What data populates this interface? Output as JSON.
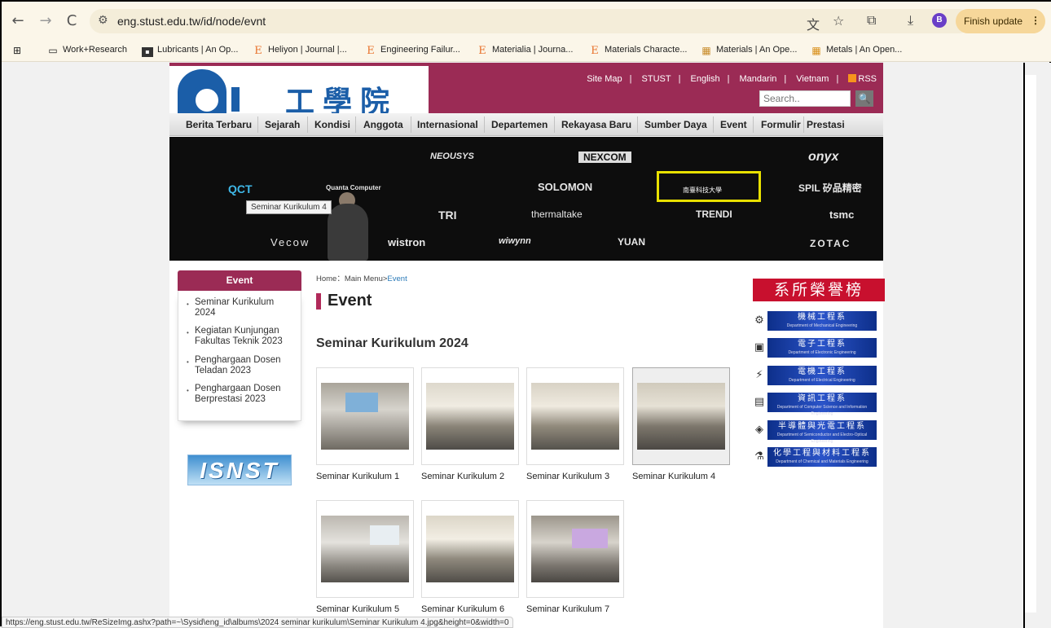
{
  "browser": {
    "url": "eng.stust.edu.tw/id/node/evnt",
    "avatar_letter": "B",
    "update_button": "Finish update",
    "icons": {
      "back": "←",
      "forward": "→",
      "reload": "C",
      "site_info": "⚙",
      "translate": "文",
      "star": "☆",
      "extensions": "⧉",
      "download": "⤓",
      "menu": "⋮",
      "apps": "⊞"
    },
    "bookmarks": [
      {
        "label": "Work+Research",
        "icon": "folder-icon",
        "glyph": "▭"
      },
      {
        "label": "Lubricants | An Op...",
        "icon": "mdpi-icon",
        "glyph": "▪"
      },
      {
        "label": "Heliyon | Journal |...",
        "icon": "elsevier-icon",
        "glyph": "E"
      },
      {
        "label": "Engineering Failur...",
        "icon": "elsevier-icon",
        "glyph": "E"
      },
      {
        "label": "Materialia | Journa...",
        "icon": "elsevier-icon",
        "glyph": "E"
      },
      {
        "label": "Materials Characte...",
        "icon": "elsevier-icon",
        "glyph": "E"
      },
      {
        "label": "Materials | An Ope...",
        "icon": "mdpi-icon",
        "glyph": "▦"
      },
      {
        "label": "Metals | An Open...",
        "icon": "mdpi-icon",
        "glyph": "▦"
      }
    ],
    "status_url": "https://eng.stust.edu.tw/ReSizeImg.ashx?path=~\\Sysid\\eng_id\\albums\\2024 seminar kurikulum\\Seminar Kurikulum 4.jpg&height=0&width=0"
  },
  "site": {
    "logo_text": "工學院",
    "top_links": [
      "Site Map",
      "STUST",
      "English",
      "Mandarin",
      "Vietnam",
      "RSS"
    ],
    "search_placeholder": "Search..",
    "search_icon": "🔍",
    "menu": [
      "Berita Terbaru",
      "Sejarah",
      "Kondisi",
      "Anggota",
      "Internasional",
      "Departemen",
      "Rekayasa Baru",
      "Sumber Daya",
      "Event",
      "Formulir",
      "Prestasi"
    ],
    "banner_tooltip": "Seminar Kurikulum 4",
    "banner_logos": [
      "NEOUSYS",
      "NEXCOM",
      "onyx",
      "QCT",
      "Quanta Computer",
      "SOLOMON",
      "SPIL 矽品精密",
      "TRI",
      "thermaltake",
      "TRENDI",
      "tsmc",
      "Vecow",
      "wistron",
      "wiwynn",
      "YUAN",
      "ZOTAC"
    ],
    "highlight_text": "南臺科技大學"
  },
  "sidebar": {
    "title": "Event",
    "items": [
      "Seminar Kurikulum 2024",
      "Kegiatan Kunjungan Fakultas Teknik 2023",
      "Penghargaan Dosen Teladan 2023",
      "Penghargaan Dosen Berprestasi 2023"
    ],
    "banner": "ISNST"
  },
  "breadcrumb": {
    "home": "Home",
    "sep": "：",
    "menu": "Main Menu",
    "arrow": ">",
    "current": "Event"
  },
  "main": {
    "title": "Event",
    "album_title": "Seminar Kurikulum 2024",
    "photos": [
      "Seminar Kurikulum 1",
      "Seminar Kurikulum 2",
      "Seminar Kurikulum 3",
      "Seminar Kurikulum 4",
      "Seminar Kurikulum 5",
      "Seminar Kurikulum 6",
      "Seminar Kurikulum 7"
    ]
  },
  "honors": {
    "title": "系所榮譽榜",
    "departments": [
      {
        "cn": "機械工程系",
        "en": "Department of Mechanical Engineering",
        "icon": "gear-icon",
        "glyph": "⚙"
      },
      {
        "cn": "電子工程系",
        "en": "Department of Electronic Engineering",
        "icon": "chip-icon",
        "glyph": "▣"
      },
      {
        "cn": "電機工程系",
        "en": "Department of Electrical Engineering",
        "icon": "motor-icon",
        "glyph": "⚡"
      },
      {
        "cn": "資訊工程系",
        "en": "Department of Computer Science and Information Engineering",
        "icon": "computer-icon",
        "glyph": "▤"
      },
      {
        "cn": "半導體與光電工程系",
        "en": "Department of Semiconductor and Electro-Optical Engineering",
        "icon": "diamond-icon",
        "glyph": "◈"
      },
      {
        "cn": "化學工程與材料工程系",
        "en": "Department of Chemical and Materials Engineering",
        "icon": "flask-icon",
        "glyph": "⚗"
      }
    ]
  }
}
